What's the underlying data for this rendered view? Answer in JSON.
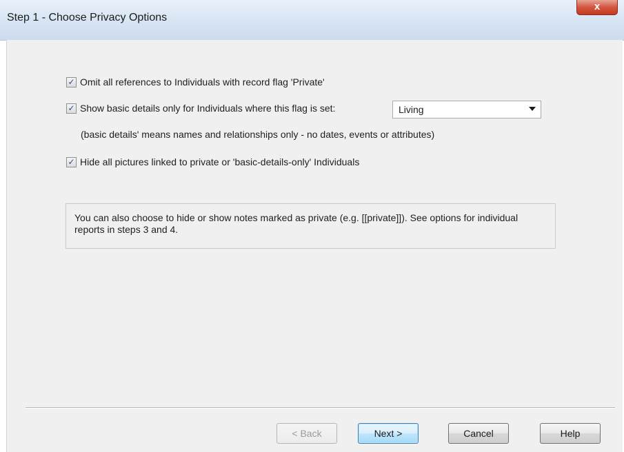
{
  "window": {
    "title": "Step 1 - Choose Privacy Options",
    "close_glyph": "x"
  },
  "options": {
    "omit_private": {
      "checked": true,
      "label": "Omit all references to Individuals with record flag 'Private'"
    },
    "show_basic": {
      "checked": true,
      "label": "Show basic details only for Individuals where this flag is set:",
      "flag_dropdown_value": "Living",
      "note": "(basic details' means names and relationships only - no dates, events or attributes)"
    },
    "hide_pictures": {
      "checked": true,
      "label": "Hide all pictures linked to private or 'basic-details-only' Individuals"
    }
  },
  "info": {
    "text": "You can also choose to hide or show notes marked as private (e.g. [[private]]).  See options for individual reports in steps 3 and 4."
  },
  "buttons": {
    "back": "< Back",
    "next": "Next >",
    "cancel": "Cancel",
    "help": "Help"
  },
  "icons": {
    "checkbox_tick": "✓",
    "close": "close-icon",
    "dropdown_arrow": "chevron-down-icon"
  },
  "colors": {
    "titlebar": "#d6e4f3",
    "close_button": "#c23a22",
    "client_bg": "#f0f0f0",
    "default_button": "#bee6fd"
  }
}
